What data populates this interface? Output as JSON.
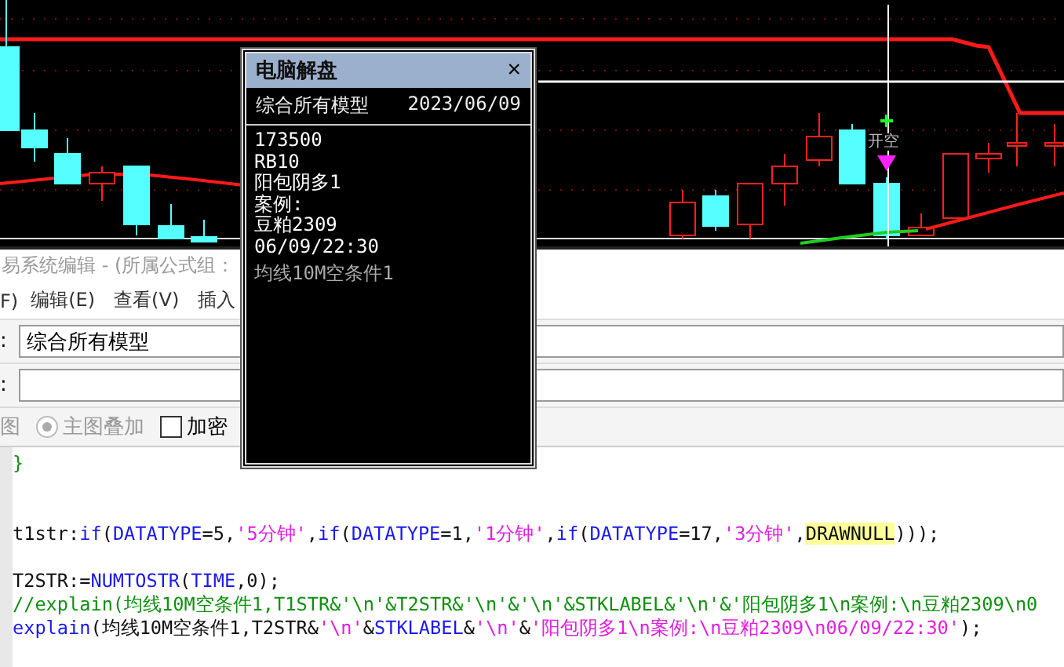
{
  "chart": {
    "signal_label": "开空"
  },
  "popup": {
    "title": "电脑解盘",
    "close": "×",
    "model": "综合所有模型",
    "date": "2023/06/09",
    "lines": [
      {
        "text": "173500",
        "kind": "normal"
      },
      {
        "text": "RB10",
        "kind": "normal"
      },
      {
        "text": "阳包阴多1",
        "kind": "normal"
      },
      {
        "text": "案例:",
        "kind": "normal"
      },
      {
        "text": "豆粕2309",
        "kind": "normal"
      },
      {
        "text": "06/09/22:30",
        "kind": "normal"
      },
      {
        "text": "均线10M空条件1",
        "kind": "dim"
      }
    ]
  },
  "window": {
    "title": "易系统编辑 - (所属公式组："
  },
  "menu": [
    "F)",
    "编辑(E)",
    "查看(V)",
    "插入"
  ],
  "fields": [
    {
      "label": ":",
      "value": "综合所有模型"
    },
    {
      "label": ":"
    }
  ],
  "options": [
    {
      "kind": "text",
      "label": "图"
    },
    {
      "kind": "radio",
      "label": "主图叠加",
      "selected": true
    },
    {
      "kind": "checkbox",
      "label": "加密",
      "checked": false
    }
  ],
  "code": [
    {
      "kind": "code",
      "tokens": [
        {
          "t": "}",
          "kind": "comment"
        }
      ]
    },
    {
      "kind": "blank"
    },
    {
      "kind": "blank"
    },
    {
      "kind": "code",
      "tokens": [
        {
          "t": "t1str:",
          "kind": "plain"
        },
        {
          "t": "if",
          "kind": "keyword"
        },
        {
          "t": "(",
          "kind": "plain"
        },
        {
          "t": "DATATYPE",
          "kind": "keyword"
        },
        {
          "t": "=5,",
          "kind": "plain"
        },
        {
          "t": "'5分钟'",
          "kind": "string"
        },
        {
          "t": ",",
          "kind": "plain"
        },
        {
          "t": "if",
          "kind": "keyword"
        },
        {
          "t": "(",
          "kind": "plain"
        },
        {
          "t": "DATATYPE",
          "kind": "keyword"
        },
        {
          "t": "=1,",
          "kind": "plain"
        },
        {
          "t": "'1分钟'",
          "kind": "string"
        },
        {
          "t": ",",
          "kind": "plain"
        },
        {
          "t": "if",
          "kind": "keyword"
        },
        {
          "t": "(",
          "kind": "plain"
        },
        {
          "t": "DATATYPE",
          "kind": "keyword"
        },
        {
          "t": "=17,",
          "kind": "plain"
        },
        {
          "t": "'3分钟'",
          "kind": "string"
        },
        {
          "t": ",",
          "kind": "plain"
        },
        {
          "t": "DRAWNULL",
          "kind": "highlight"
        },
        {
          "t": ")));",
          "kind": "plain"
        }
      ]
    },
    {
      "kind": "blank"
    },
    {
      "kind": "code",
      "tokens": [
        {
          "t": "T2STR:=",
          "kind": "plain"
        },
        {
          "t": "NUMTOSTR",
          "kind": "keyword"
        },
        {
          "t": "(",
          "kind": "plain"
        },
        {
          "t": "TIME",
          "kind": "keyword"
        },
        {
          "t": ",0);",
          "kind": "plain"
        }
      ]
    },
    {
      "kind": "code",
      "tokens": [
        {
          "t": "//explain(均线10M空条件1,T1STR&'\\n'&T2STR&'\\n'&'\\n'&STKLABEL&'\\n'&'阳包阴多1\\n案例:\\n豆粕2309\\n0",
          "kind": "comment"
        }
      ]
    },
    {
      "kind": "code",
      "tokens": [
        {
          "t": "explain",
          "kind": "keyword"
        },
        {
          "t": "(均线10M空条件1,T2STR&",
          "kind": "plain"
        },
        {
          "t": "'\\n'",
          "kind": "string"
        },
        {
          "t": "&",
          "kind": "plain"
        },
        {
          "t": "STKLABEL",
          "kind": "keyword"
        },
        {
          "t": "&",
          "kind": "plain"
        },
        {
          "t": "'\\n'",
          "kind": "string"
        },
        {
          "t": "&",
          "kind": "plain"
        },
        {
          "t": "'阳包阴多1\\n案例:\\n豆粕2309\\n06/09/22:30'",
          "kind": "string"
        },
        {
          "t": ");",
          "kind": "plain"
        }
      ]
    }
  ]
}
